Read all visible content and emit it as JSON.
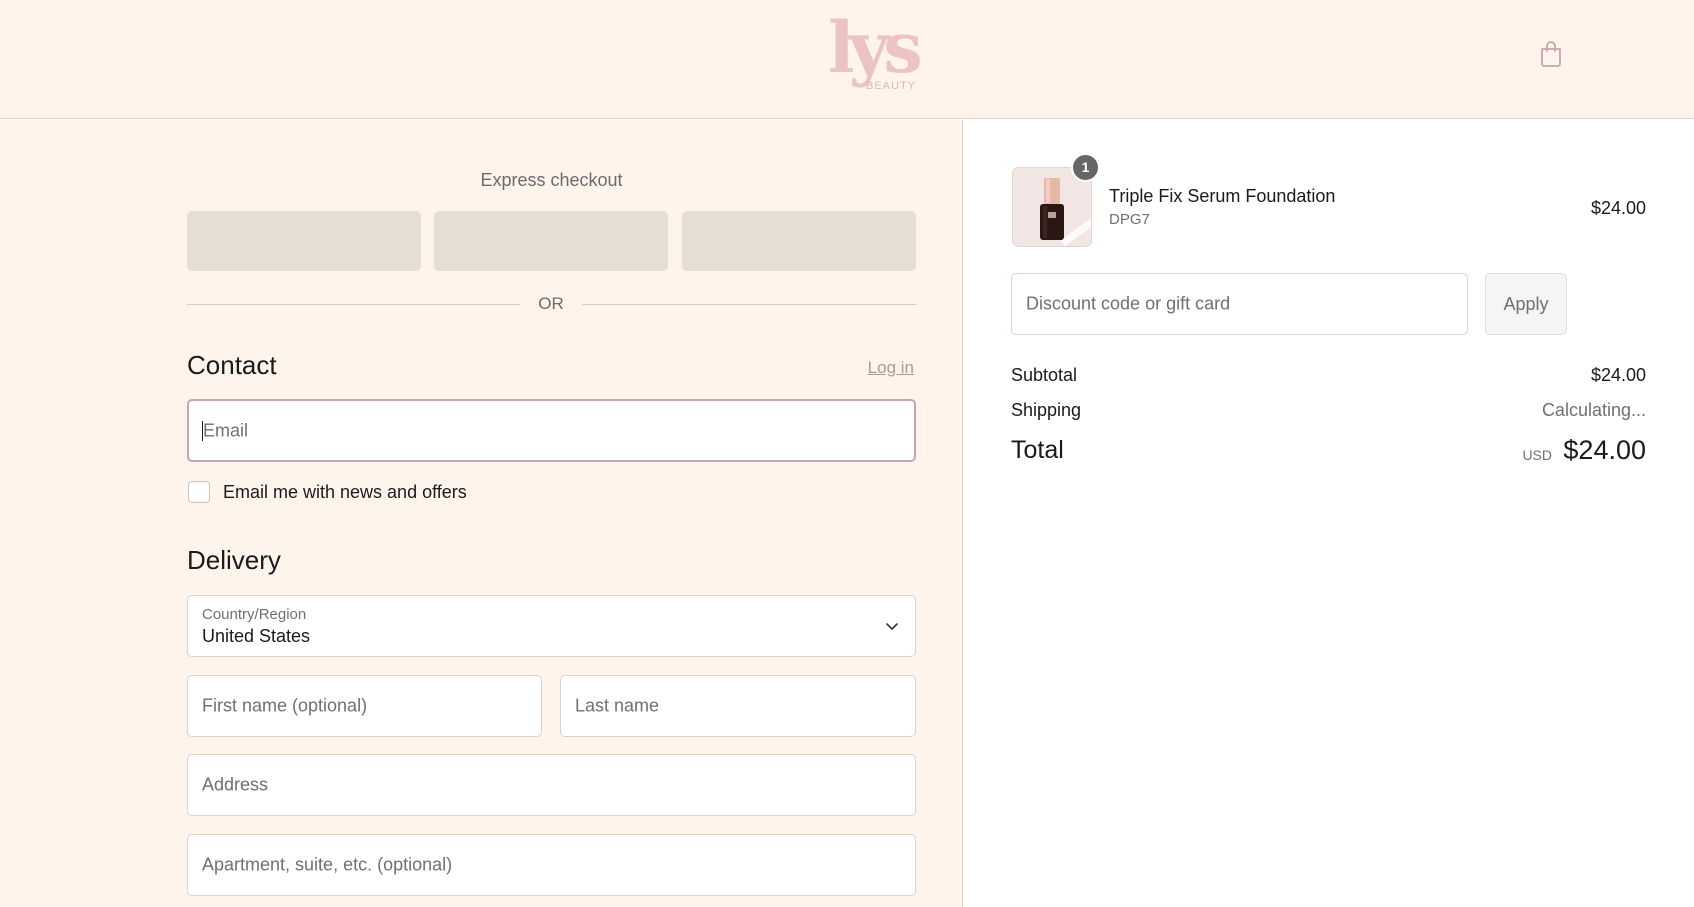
{
  "header": {
    "logo_text": "lys",
    "logo_sub": "BEAUTY",
    "cart_icon": "shopping-bag-icon"
  },
  "express": {
    "title": "Express checkout",
    "buttons_count_note": ""
  },
  "divider": {
    "or_label": "OR"
  },
  "contact": {
    "title": "Contact",
    "login_label": "Log in",
    "email_placeholder": "Email",
    "newsletter_label": "Email me with news and offers"
  },
  "delivery": {
    "title": "Delivery",
    "country_label": "Country/Region",
    "country_value": "United States",
    "first_name_placeholder": "First name (optional)",
    "last_name_placeholder": "Last name",
    "address_placeholder": "Address",
    "apartment_placeholder": "Apartment, suite, etc. (optional)"
  },
  "order": {
    "item": {
      "quantity": "1",
      "name": "Triple Fix Serum Foundation",
      "variant": "DPG7",
      "price": "$24.00"
    },
    "discount_placeholder": "Discount code or gift card",
    "apply_label": "Apply",
    "subtotal_label": "Subtotal",
    "subtotal_value": "$24.00",
    "shipping_label": "Shipping",
    "shipping_value": "Calculating...",
    "total_label": "Total",
    "total_currency": "USD",
    "total_value": "$24.00"
  },
  "colors": {
    "page_bg": "#fff4ec",
    "express_btn": "#e6ddd4",
    "focus_border": "#c9a3ad",
    "logo": "#ebc3c5"
  }
}
